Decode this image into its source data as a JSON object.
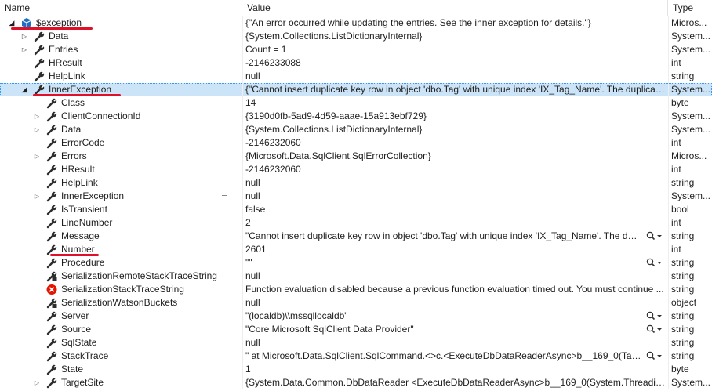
{
  "columns": {
    "name": "Name",
    "value": "Value",
    "type": "Type"
  },
  "rows": [
    {
      "level": 0,
      "expander": "open",
      "icon": "object-icon",
      "name": "$exception",
      "value": "{\"An error occurred while updating the entries. See the inner exception for details.\"}",
      "type": "Micros...",
      "underline": true
    },
    {
      "level": 1,
      "expander": "closed",
      "icon": "wrench-icon",
      "name": "Data",
      "value": "{System.Collections.ListDictionaryInternal}",
      "type": "System..."
    },
    {
      "level": 1,
      "expander": "closed",
      "icon": "wrench-icon",
      "name": "Entries",
      "value": "Count = 1",
      "type": "System..."
    },
    {
      "level": 1,
      "expander": "none",
      "icon": "wrench-icon",
      "name": "HResult",
      "value": "-2146233088",
      "type": "int"
    },
    {
      "level": 1,
      "expander": "none",
      "icon": "wrench-icon",
      "name": "HelpLink",
      "value": "null",
      "type": "string"
    },
    {
      "level": 1,
      "expander": "open",
      "icon": "wrench-icon",
      "name": "InnerException",
      "value": "{\"Cannot insert duplicate key row in object 'dbo.Tag' with unique index 'IX_Tag_Name'. The duplicat...",
      "type": "System...",
      "underline": true,
      "selected": true
    },
    {
      "level": 2,
      "expander": "none",
      "icon": "wrench-icon",
      "name": "Class",
      "value": "14",
      "type": "byte"
    },
    {
      "level": 2,
      "expander": "closed",
      "icon": "wrench-icon",
      "name": "ClientConnectionId",
      "value": "{3190d0fb-5ad9-4d59-aaae-15a913ebf729}",
      "type": "System..."
    },
    {
      "level": 2,
      "expander": "closed",
      "icon": "wrench-icon",
      "name": "Data",
      "value": "{System.Collections.ListDictionaryInternal}",
      "type": "System..."
    },
    {
      "level": 2,
      "expander": "none",
      "icon": "wrench-icon",
      "name": "ErrorCode",
      "value": "-2146232060",
      "type": "int"
    },
    {
      "level": 2,
      "expander": "closed",
      "icon": "wrench-icon",
      "name": "Errors",
      "value": "{Microsoft.Data.SqlClient.SqlErrorCollection}",
      "type": "Micros..."
    },
    {
      "level": 2,
      "expander": "none",
      "icon": "wrench-icon",
      "name": "HResult",
      "value": "-2146232060",
      "type": "int"
    },
    {
      "level": 2,
      "expander": "none",
      "icon": "wrench-icon",
      "name": "HelpLink",
      "value": "null",
      "type": "string"
    },
    {
      "level": 2,
      "expander": "closed",
      "icon": "wrench-icon",
      "name": "InnerException",
      "value": "null",
      "type": "System...",
      "pin": true
    },
    {
      "level": 2,
      "expander": "none",
      "icon": "wrench-icon",
      "name": "IsTransient",
      "value": "false",
      "type": "bool"
    },
    {
      "level": 2,
      "expander": "none",
      "icon": "wrench-icon",
      "name": "LineNumber",
      "value": "2",
      "type": "int"
    },
    {
      "level": 2,
      "expander": "none",
      "icon": "wrench-icon",
      "name": "Message",
      "value": "\"Cannot insert duplicate key row in object 'dbo.Tag' with unique index 'IX_Tag_Name'. The dupl...",
      "type": "string",
      "magnifier": true
    },
    {
      "level": 2,
      "expander": "none",
      "icon": "wrench-icon",
      "name": "Number",
      "value": "2601",
      "type": "int",
      "underline": true
    },
    {
      "level": 2,
      "expander": "none",
      "icon": "wrench-icon",
      "name": "Procedure",
      "value": "\"\"",
      "type": "string",
      "magnifier": true
    },
    {
      "level": 2,
      "expander": "none",
      "icon": "wrench-lock-icon",
      "name": "SerializationRemoteStackTraceString",
      "value": "null",
      "type": "string"
    },
    {
      "level": 2,
      "expander": "none",
      "icon": "error-icon",
      "name": "SerializationStackTraceString",
      "value": "Function evaluation disabled because a previous function evaluation timed out. You must continue ...",
      "type": "string"
    },
    {
      "level": 2,
      "expander": "none",
      "icon": "wrench-lock-icon",
      "name": "SerializationWatsonBuckets",
      "value": "null",
      "type": "object"
    },
    {
      "level": 2,
      "expander": "none",
      "icon": "wrench-icon",
      "name": "Server",
      "value": "\"(localdb)\\\\mssqllocaldb\"",
      "type": "string",
      "magnifier": true
    },
    {
      "level": 2,
      "expander": "none",
      "icon": "wrench-icon",
      "name": "Source",
      "value": "\"Core Microsoft SqlClient Data Provider\"",
      "type": "string",
      "magnifier": true
    },
    {
      "level": 2,
      "expander": "none",
      "icon": "wrench-icon",
      "name": "SqlState",
      "value": "null",
      "type": "string"
    },
    {
      "level": 2,
      "expander": "none",
      "icon": "wrench-icon",
      "name": "StackTrace",
      "value": "\"   at Microsoft.Data.SqlClient.SqlCommand.<>c.<ExecuteDbDataReaderAsync>b__169_0(Task`...",
      "type": "string",
      "magnifier": true
    },
    {
      "level": 2,
      "expander": "none",
      "icon": "wrench-icon",
      "name": "State",
      "value": "1",
      "type": "byte"
    },
    {
      "level": 2,
      "expander": "closed",
      "icon": "wrench-icon",
      "name": "TargetSite",
      "value": "{System.Data.Common.DbDataReader <ExecuteDbDataReaderAsync>b__169_0(System.Threading.Ta...",
      "type": "System..."
    }
  ],
  "colors": {
    "selection": "#cce4f7",
    "underline": "#e0102a",
    "object_icon": "#1c6fc2",
    "error_icon": "#e51400"
  }
}
